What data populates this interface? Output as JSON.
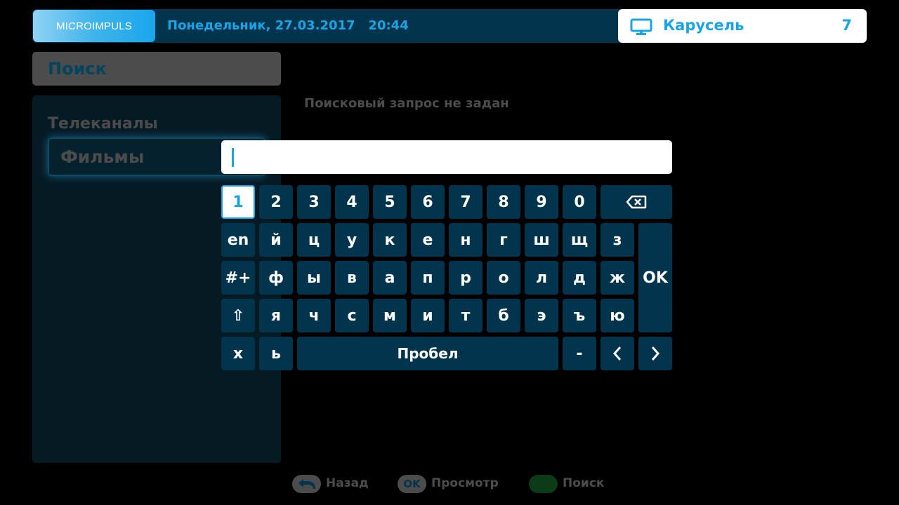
{
  "header": {
    "logo": "MICROIMPULS",
    "datetime": "Понедельник, 27.03.2017   20:44",
    "channel": {
      "icon": "tv-icon",
      "name": "Карусель",
      "number": "7"
    }
  },
  "search": {
    "title": "Поиск",
    "empty_message": "Поисковый запрос не задан",
    "input_value": ""
  },
  "categories": [
    {
      "label": "Телеканалы"
    },
    {
      "label": "Фильмы",
      "selected": true
    }
  ],
  "keyboard": {
    "row1": [
      "1",
      "2",
      "3",
      "4",
      "5",
      "6",
      "7",
      "8",
      "9",
      "0"
    ],
    "row2": [
      "en",
      "й",
      "ц",
      "у",
      "к",
      "е",
      "н",
      "г",
      "ш",
      "щ",
      "з"
    ],
    "row3": [
      "#+",
      "ф",
      "ы",
      "в",
      "а",
      "п",
      "р",
      "о",
      "л",
      "д",
      "ж"
    ],
    "row4": [
      "⇧",
      "я",
      "ч",
      "с",
      "м",
      "и",
      "т",
      "б",
      "э",
      "ъ",
      "ю"
    ],
    "row5": {
      "x": "х",
      "soft": "ь",
      "space": "Пробел",
      "dash": "-"
    },
    "ok": "OK",
    "selected_key": "1",
    "icons": {
      "backspace": "backspace-icon",
      "left": "chevron-left-icon",
      "right": "chevron-right-icon"
    }
  },
  "footer": {
    "back": {
      "icon": "back-arrow-icon",
      "label": "Назад"
    },
    "ok": {
      "badge": "OK",
      "label": "Просмотр"
    },
    "green": {
      "label": "Поиск",
      "color": "#0b3b17"
    }
  },
  "colors": {
    "accent": "#1ba4e3",
    "key_bg": "#02344d",
    "header_bg": "#02344d"
  }
}
